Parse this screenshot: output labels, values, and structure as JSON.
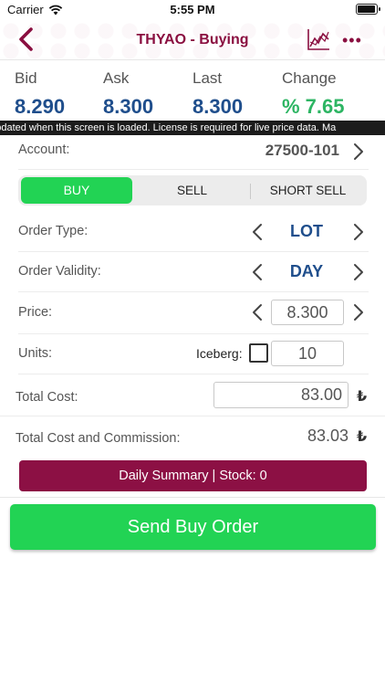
{
  "status_bar": {
    "carrier": "Carrier",
    "time": "5:55 PM"
  },
  "nav": {
    "title": "THYAO - Buying",
    "more": "•••"
  },
  "quote": {
    "bid_label": "Bid",
    "bid": "8.290",
    "ask_label": "Ask",
    "ask": "8.300",
    "last_label": "Last",
    "last": "8.300",
    "change_label": "Change",
    "change": "% 7.65"
  },
  "ticker": "nly updated when this screen is loaded. License is required for live price data. Ma",
  "account": {
    "label": "Account:",
    "value": "27500-101"
  },
  "order_side": {
    "buy": "BUY",
    "sell": "SELL",
    "short_sell": "SHORT SELL",
    "selected": "BUY"
  },
  "order_type": {
    "label": "Order Type:",
    "value": "LOT"
  },
  "order_validity": {
    "label": "Order Validity:",
    "value": "DAY"
  },
  "price": {
    "label": "Price:",
    "value": "8.300"
  },
  "units": {
    "label": "Units:",
    "iceberg_label": "Iceberg:",
    "iceberg_checked": false,
    "value": "10"
  },
  "total_cost": {
    "label": "Total Cost:",
    "value": "83.00",
    "currency": "₺"
  },
  "total_commission": {
    "label": "Total Cost and Commission:",
    "value": "83.03",
    "currency": "₺"
  },
  "daily_summary": "Daily Summary | Stock: 0",
  "send_button": "Send Buy Order",
  "colors": {
    "brand": "#8c1044",
    "accent_green": "#22d354",
    "value_blue": "#1f4e8c",
    "change_green": "#2db563"
  }
}
